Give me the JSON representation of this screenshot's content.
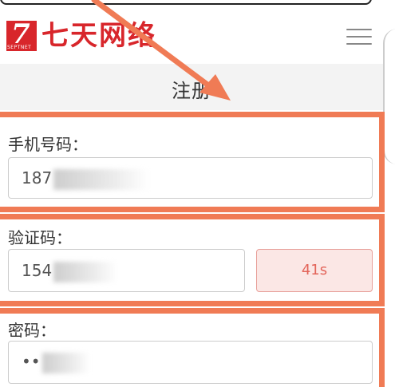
{
  "header": {
    "logo_text": "七天网络",
    "logo_mark_glyph": "7",
    "logo_mark_subtext": "SEPTNET"
  },
  "page": {
    "title": "注册"
  },
  "form": {
    "phone": {
      "label": "手机号码：",
      "value_visible": "187"
    },
    "code": {
      "label": "验证码：",
      "value_visible": "154",
      "button_label": "41s"
    },
    "password": {
      "label": "密码：",
      "value_visible": "••"
    }
  },
  "colors": {
    "brand_red": "#d8262b",
    "annotation_orange": "#f07b55",
    "code_button_bg": "#fbe7e5",
    "code_button_text": "#e3655a"
  },
  "icons": {
    "menu": "hamburger-menu-icon"
  }
}
